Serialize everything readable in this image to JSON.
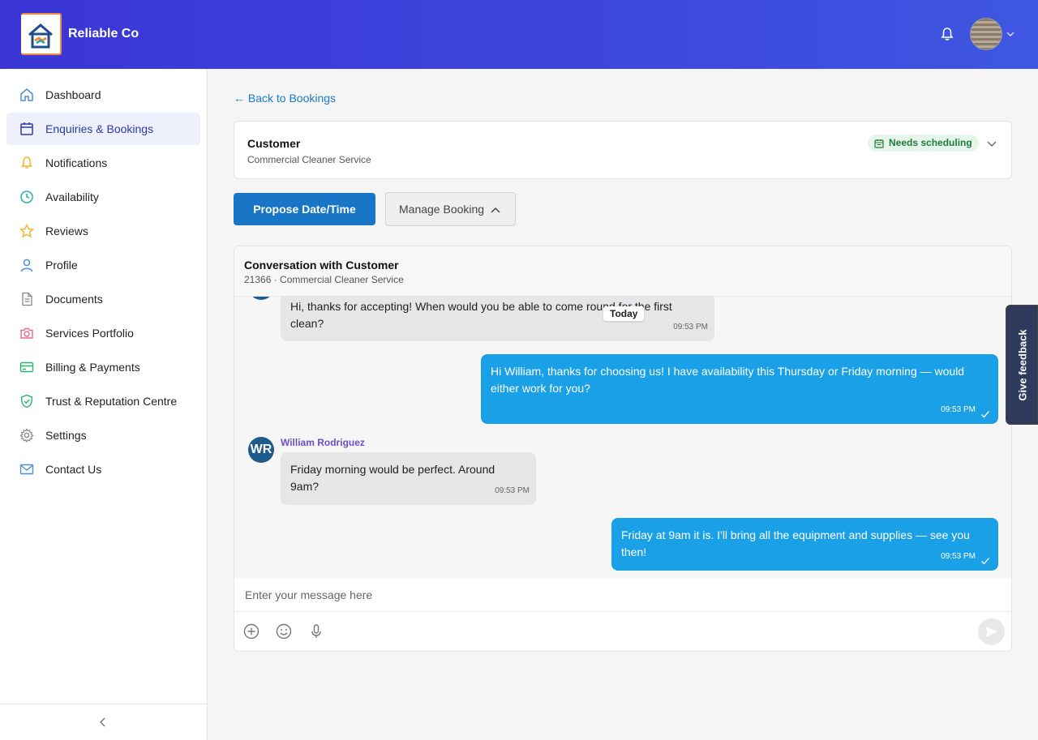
{
  "header": {
    "brand": "Reliable Co",
    "logo_icon": "house-handshake-logo",
    "bell_icon": "bell-icon",
    "avatar_icon": "avatar"
  },
  "sidebar": {
    "items": [
      {
        "label": "Dashboard",
        "icon": "home-icon",
        "active": false
      },
      {
        "label": "Enquiries & Bookings",
        "icon": "calendar-icon",
        "active": true
      },
      {
        "label": "Notifications",
        "icon": "bell-icon",
        "active": false
      },
      {
        "label": "Availability",
        "icon": "clock-icon",
        "active": false
      },
      {
        "label": "Reviews",
        "icon": "star-icon",
        "active": false
      },
      {
        "label": "Profile",
        "icon": "user-icon",
        "active": false
      },
      {
        "label": "Documents",
        "icon": "document-icon",
        "active": false
      },
      {
        "label": "Services Portfolio",
        "icon": "camera-icon",
        "active": false
      },
      {
        "label": "Billing & Payments",
        "icon": "credit-card-icon",
        "active": false
      },
      {
        "label": "Trust & Reputation Centre",
        "icon": "shield-check-icon",
        "active": false
      },
      {
        "label": "Settings",
        "icon": "gear-icon",
        "active": false
      },
      {
        "label": "Contact Us",
        "icon": "mail-icon",
        "active": false
      }
    ]
  },
  "main": {
    "back_link": "← Back to Bookings",
    "customer_card": {
      "title": "Customer",
      "service": "Commercial Cleaner Service",
      "status": "Needs scheduling"
    },
    "actions": {
      "propose": "Propose Date/Time",
      "manage": "Manage Booking"
    },
    "conversation": {
      "title": "Conversation with Customer",
      "subtitle": "21366 · Commercial Cleaner Service",
      "date_divider": "Today",
      "sender_name": "William Rodriguez",
      "sender_initials": "WR",
      "messages": [
        {
          "direction": "in",
          "text": "Hi, thanks for accepting! When would you be able to come round for the first clean?",
          "time": "09:53 PM"
        },
        {
          "direction": "out",
          "text": "Hi William, thanks for choosing us! I have availability this Thursday or Friday morning — would either work for you?",
          "time": "09:53 PM"
        },
        {
          "direction": "in",
          "text": "Friday morning would be perfect. Around 9am?",
          "time": "09:53 PM"
        },
        {
          "direction": "out",
          "text": "Friday at 9am it is. I'll bring all the equipment and supplies — see you then!",
          "time": "09:53 PM"
        }
      ],
      "input_placeholder": "Enter your message here"
    }
  },
  "feedback_tab": "Give feedback",
  "colors": {
    "header_gradient_start": "#3b35d6",
    "primary": "#1976c6",
    "outgoing_bubble": "#1aa0e6",
    "incoming_bubble": "#e6e6e8"
  }
}
